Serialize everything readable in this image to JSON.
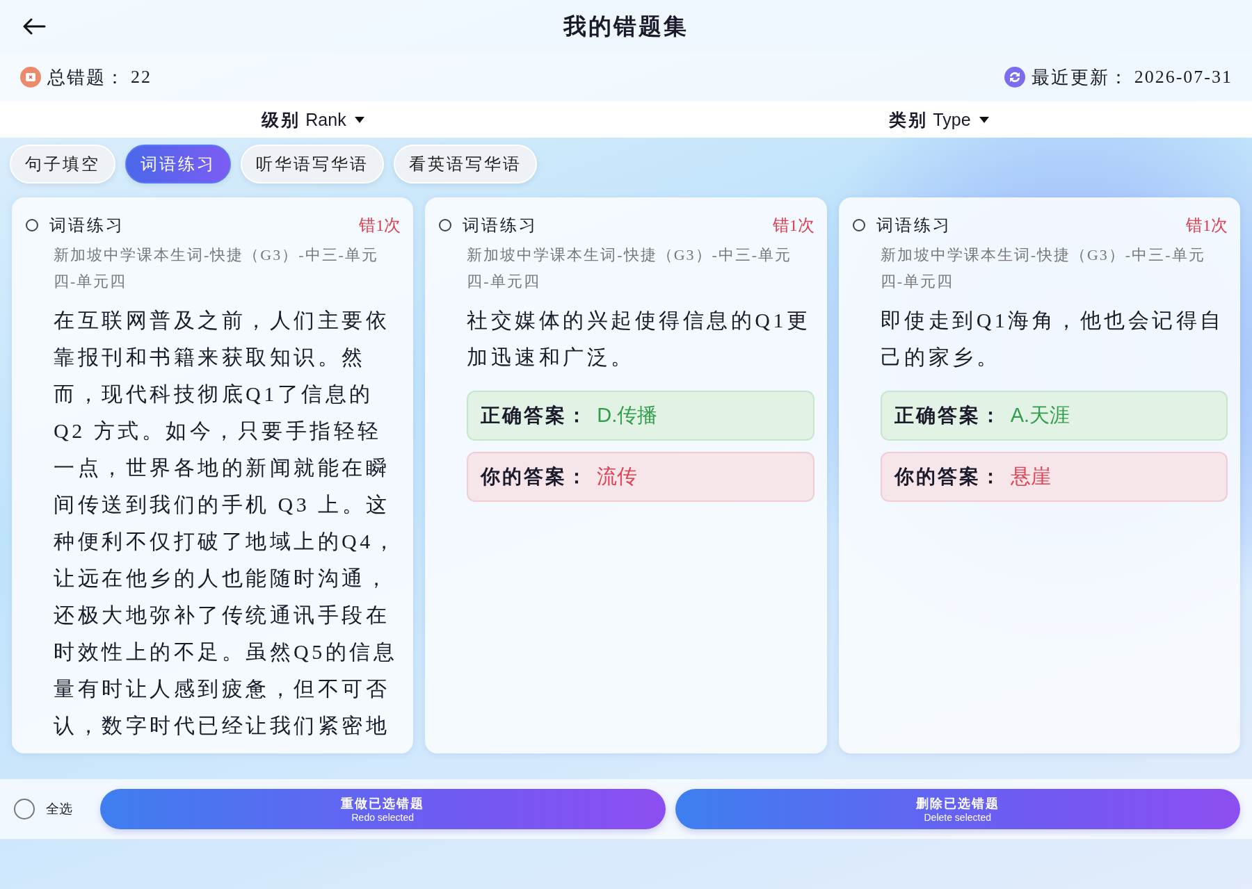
{
  "header": {
    "title": "我的错题集"
  },
  "stats": {
    "total_label": "总错题：",
    "total_value": "22",
    "updated_label": "最近更新：",
    "updated_value": "2026-07-31"
  },
  "filters": [
    {
      "label": "**级别** Rank"
    },
    {
      "label": "**类别** Type"
    }
  ],
  "tabs": [
    {
      "label": "句子填空",
      "selected": false
    },
    {
      "label": "词语练习",
      "selected": true
    },
    {
      "label": "听华语写华语",
      "selected": false
    },
    {
      "label": "看英语写华语",
      "selected": false
    }
  ],
  "cards": [
    {
      "checked": false,
      "category": "词语练习",
      "mistakes": "错1次",
      "source": "新加坡中学课本生词-快捷（G3）-中三-单元四-单元四",
      "question": "在互联网普及之前，人们主要依靠报刊和书籍来获取知识。然而，现代科技彻底Q1了信息的Q2 方式。如今，只要手指轻轻一点，世界各地的新闻就能在瞬间传送到我们的手机 Q3 上。这种便利不仅打破了地域上的Q4，让远在他乡的人也能随时沟通，还极大地弥补了传统通讯手段在时效性上的不足。虽然Q5的信息量有时让人感到疲惫，但不可否认，数字时代已经让我们紧密地"
    },
    {
      "checked": false,
      "category": "词语练习",
      "mistakes": "错1次",
      "source": "新加坡中学课本生词-快捷（G3）-中三-单元四-单元四",
      "question": "社交媒体的兴起使得信息的Q1更加迅速和广泛。",
      "answers": [
        {
          "kind": "correct",
          "label": "正确答案：",
          "value": "D.传播"
        },
        {
          "kind": "wrong",
          "label": "你的答案：",
          "value": "流传"
        }
      ]
    },
    {
      "checked": false,
      "category": "词语练习",
      "mistakes": "错1次",
      "source": "新加坡中学课本生词-快捷（G3）-中三-单元四-单元四",
      "question": "即使走到Q1海角，他也会记得自己的家乡。",
      "answers": [
        {
          "kind": "correct",
          "label": "正确答案：",
          "value": "A.天涯"
        },
        {
          "kind": "wrong",
          "label": "你的答案：",
          "value": "悬崖"
        }
      ]
    }
  ],
  "footer": {
    "select_all": {
      "label": "全选",
      "checked": false
    },
    "buttons": [
      {
        "label": "重做已选错题",
        "sublabel": "Redo selected"
      },
      {
        "label": "删除已选错题",
        "sublabel": "Delete selected"
      }
    ]
  }
}
